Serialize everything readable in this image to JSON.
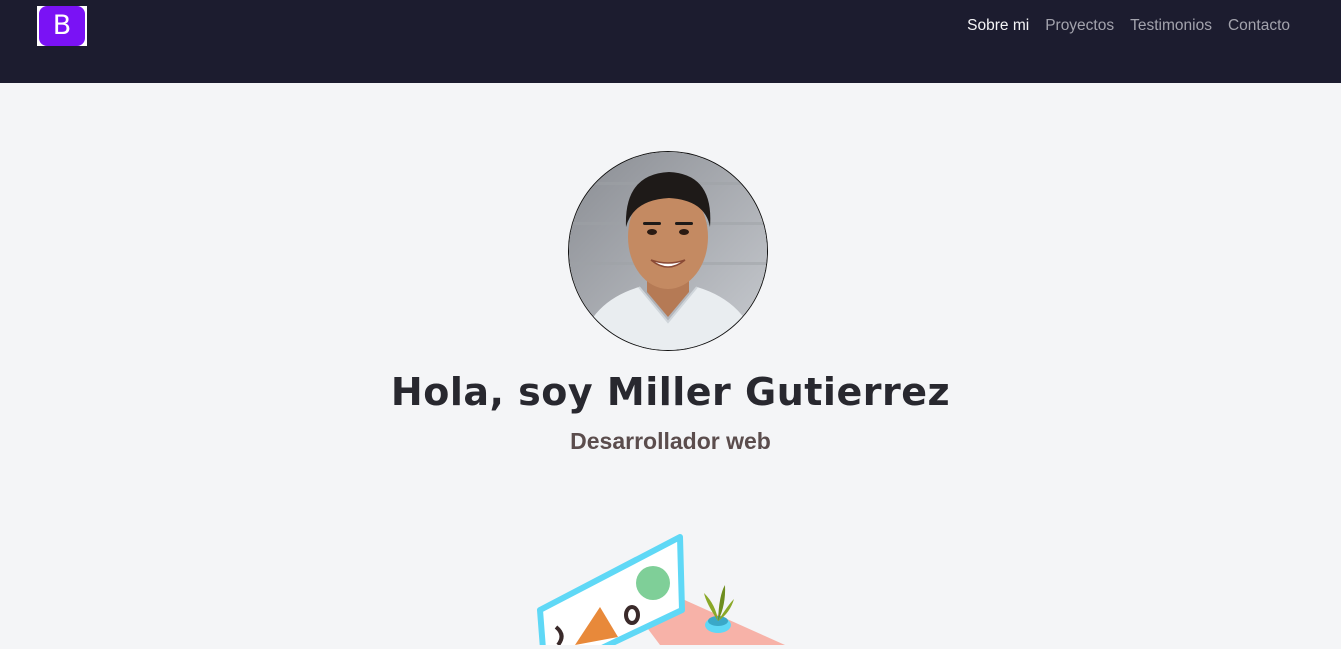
{
  "navbar": {
    "brand_letter": "B",
    "links": [
      {
        "label": "Sobre mi",
        "active": true
      },
      {
        "label": "Proyectos",
        "active": false
      },
      {
        "label": "Testimonios",
        "active": false
      },
      {
        "label": "Contacto",
        "active": false
      }
    ]
  },
  "hero": {
    "title": "Hola, soy Miller Gutierrez",
    "subtitle": "Desarrollador web"
  },
  "colors": {
    "navbar_bg": "#1c1c2f",
    "page_bg": "#f4f5f7",
    "brand_purple": "#7a12f5",
    "title": "#28282f",
    "subtitle": "#5b4d4d"
  }
}
